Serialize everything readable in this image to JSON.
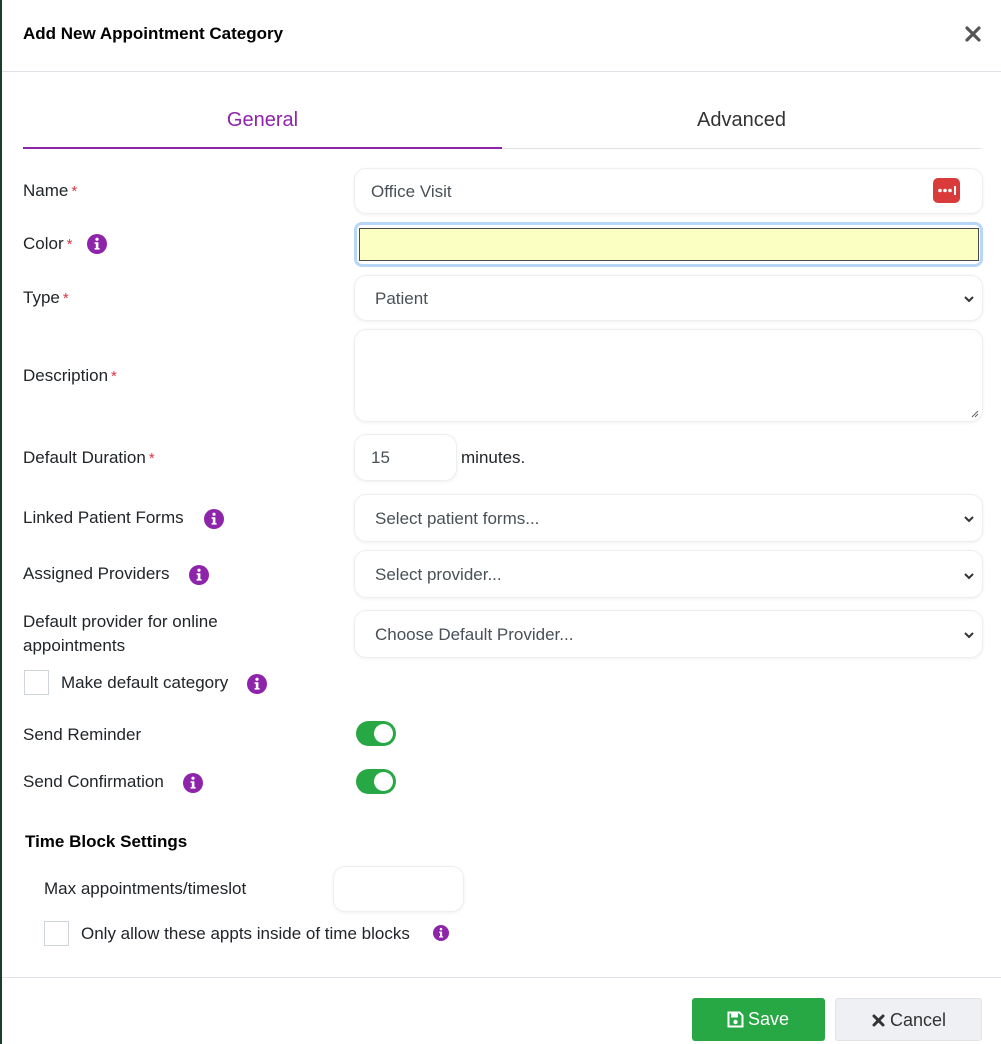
{
  "modal": {
    "title": "Add New Appointment Category"
  },
  "tabs": [
    {
      "label": "General",
      "active": true
    },
    {
      "label": "Advanced",
      "active": false
    }
  ],
  "form": {
    "required_mark": "*",
    "name": {
      "label": "Name",
      "value": "Office Visit"
    },
    "color": {
      "label": "Color",
      "value": "#fcffc2"
    },
    "type": {
      "label": "Type",
      "value": "Patient"
    },
    "description": {
      "label": "Description",
      "value": ""
    },
    "duration": {
      "label": "Default Duration",
      "value": "15",
      "suffix": "minutes."
    },
    "linked_forms": {
      "label": "Linked Patient Forms",
      "placeholder": "Select patient forms..."
    },
    "providers": {
      "label": "Assigned Providers",
      "placeholder": "Select provider..."
    },
    "default_provider": {
      "label_line1": "Default provider for online",
      "label_line2": "appointments",
      "placeholder": "Choose Default Provider..."
    },
    "make_default": {
      "label": "Make default category",
      "checked": false
    },
    "send_reminder": {
      "label": "Send Reminder",
      "on": true
    },
    "send_confirmation": {
      "label": "Send Confirmation",
      "on": true
    }
  },
  "time_block": {
    "title": "Time Block Settings",
    "max_label": "Max appointments/timeslot",
    "max_value": "",
    "only_inside_label": "Only allow these appts inside of time blocks",
    "only_inside_checked": false
  },
  "footer": {
    "save_label": "Save",
    "cancel_label": "Cancel"
  },
  "colors": {
    "accent": "#8e24aa",
    "success": "#28a745",
    "danger": "#dc3545"
  }
}
